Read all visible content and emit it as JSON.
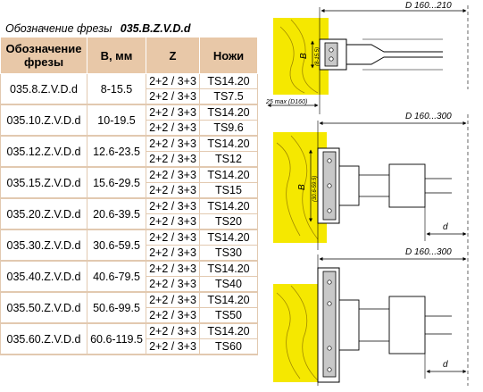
{
  "title": {
    "label": "Обозначение фрезы",
    "code": "035.B.Z.V.D.d"
  },
  "table": {
    "headers": [
      "Обозначение фрезы",
      "B, мм",
      "Z",
      "Ножи"
    ],
    "rows": [
      {
        "code": "035.8.Z.V.D.d",
        "b": "8-15.5",
        "variants": [
          {
            "z": "2+2 / 3+3",
            "knife": "TS14.20"
          },
          {
            "z": "2+2 / 3+3",
            "knife": "TS7.5"
          }
        ]
      },
      {
        "code": "035.10.Z.V.D.d",
        "b": "10-19.5",
        "variants": [
          {
            "z": "2+2 / 3+3",
            "knife": "TS14.20"
          },
          {
            "z": "2+2 / 3+3",
            "knife": "TS9.6"
          }
        ]
      },
      {
        "code": "035.12.Z.V.D.d",
        "b": "12.6-23.5",
        "variants": [
          {
            "z": "2+2 / 3+3",
            "knife": "TS14.20"
          },
          {
            "z": "2+2 / 3+3",
            "knife": "TS12"
          }
        ]
      },
      {
        "code": "035.15.Z.V.D.d",
        "b": "15.6-29.5",
        "variants": [
          {
            "z": "2+2 / 3+3",
            "knife": "TS14.20"
          },
          {
            "z": "2+2 / 3+3",
            "knife": "TS15"
          }
        ]
      },
      {
        "code": "035.20.Z.V.D.d",
        "b": "20.6-39.5",
        "variants": [
          {
            "z": "2+2 / 3+3",
            "knife": "TS14.20"
          },
          {
            "z": "2+2 / 3+3",
            "knife": "TS20"
          }
        ]
      },
      {
        "code": "035.30.Z.V.D.d",
        "b": "30.6-59.5",
        "variants": [
          {
            "z": "2+2 / 3+3",
            "knife": "TS14.20"
          },
          {
            "z": "2+2 / 3+3",
            "knife": "TS30"
          }
        ]
      },
      {
        "code": "035.40.Z.V.D.d",
        "b": "40.6-79.5",
        "variants": [
          {
            "z": "2+2 / 3+3",
            "knife": "TS14.20"
          },
          {
            "z": "2+2 / 3+3",
            "knife": "TS40"
          }
        ]
      },
      {
        "code": "035.50.Z.V.D.d",
        "b": "50.6-99.5",
        "variants": [
          {
            "z": "2+2 / 3+3",
            "knife": "TS14.20"
          },
          {
            "z": "2+2 / 3+3",
            "knife": "TS50"
          }
        ]
      },
      {
        "code": "035.60.Z.V.D.d",
        "b": "60.6-119.5",
        "variants": [
          {
            "z": "2+2 / 3+3",
            "knife": "TS14.20"
          },
          {
            "z": "2+2 / 3+3",
            "knife": "TS60"
          }
        ]
      }
    ]
  },
  "diagrams": {
    "top": {
      "d_label": "D 160...210",
      "b_label": "B",
      "b_range": "(8-15.5)",
      "max_label": "25 max (D160)"
    },
    "middle": {
      "d_label": "D 160...300",
      "b_label": "B",
      "b_range": "(30.6-59.5)",
      "small_d": "d"
    },
    "bottom": {
      "d_label": "D 160...300",
      "small_d": "d"
    }
  },
  "colors": {
    "header_bg": "#e8c8a8",
    "border": "#e2c9b0",
    "wood": "#f5e800",
    "knife": "#c8c8c8",
    "line": "#000000"
  }
}
